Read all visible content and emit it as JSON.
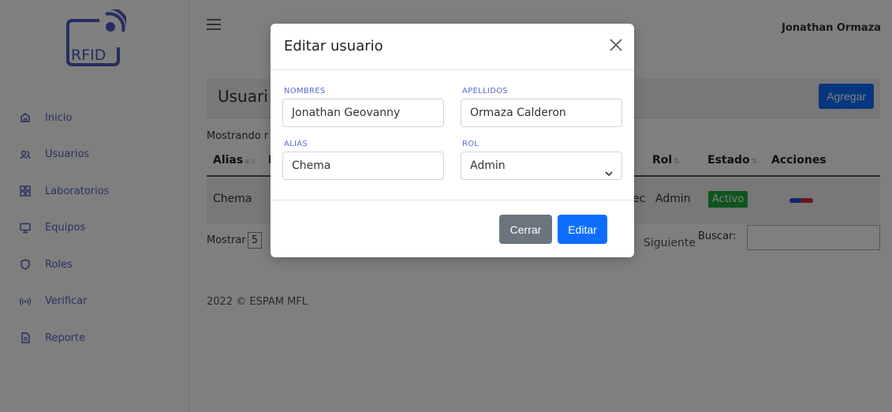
{
  "logo": {
    "text": "RFID"
  },
  "sidebar": {
    "items": [
      {
        "label": "Inicio",
        "icon": "home-icon"
      },
      {
        "label": "Usuarios",
        "icon": "users-icon"
      },
      {
        "label": "Laboratorios",
        "icon": "grid-icon"
      },
      {
        "label": "Equipos",
        "icon": "monitor-icon"
      },
      {
        "label": "Roles",
        "icon": "shield-icon"
      },
      {
        "label": "Verificar",
        "icon": "broadcast-icon"
      },
      {
        "label": "Reporte",
        "icon": "document-icon"
      }
    ]
  },
  "header": {
    "user_name": "Jonathan Ormaza"
  },
  "page": {
    "title": "Usuari",
    "add_label": "Agregar",
    "showing_text": "Mostrando r",
    "table": {
      "headers": [
        "Alias",
        "I",
        "Rol",
        "Estado",
        "Acciones"
      ],
      "row": {
        "alias": "Chema",
        "partial": "ec",
        "rol": "Admin",
        "estado": "Activo"
      }
    },
    "show_label": "Mostrar",
    "show_value": "5",
    "next_label": "Siguiente",
    "search_label": "Buscar:",
    "search_value": "",
    "footer": "2022 © ESPAM MFL"
  },
  "modal": {
    "title": "Editar usuario",
    "fields": {
      "nombres": {
        "label": "NOMBRES",
        "value": "Jonathan Geovanny"
      },
      "apellidos": {
        "label": "APELLIDOS",
        "value": "Ormaza Calderon"
      },
      "alias": {
        "label": "ALIAS",
        "value": "Chema"
      },
      "rol": {
        "label": "ROL",
        "value": "Admin"
      }
    },
    "close_label": "Cerrar",
    "edit_label": "Editar"
  },
  "colors": {
    "primary": "#0d6efd",
    "secondary": "#6c757d",
    "success": "#1ea83a",
    "danger": "#d02f3a",
    "sidebar_text": "#5465c8"
  }
}
